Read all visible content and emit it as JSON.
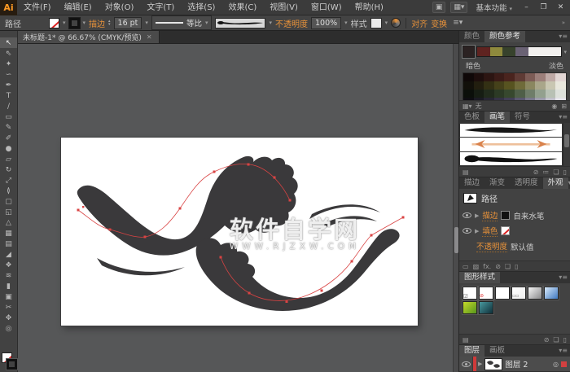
{
  "app": {
    "logo_text": "Ai",
    "workspace": "基本功能"
  },
  "menu": {
    "items": [
      "文件(F)",
      "编辑(E)",
      "对象(O)",
      "文字(T)",
      "选择(S)",
      "效果(C)",
      "视图(V)",
      "窗口(W)",
      "帮助(H)"
    ]
  },
  "window_controls": {
    "minimize": "–",
    "restore": "❐",
    "close": "✕"
  },
  "control_bar": {
    "target_label": "路径",
    "stroke_link": "描边",
    "stroke_weight": "16 pt",
    "width_profile": "等比",
    "opacity_link": "不透明度",
    "opacity_value": "100%",
    "style_label": "样式",
    "align_link": "对齐",
    "transform_link": "变换",
    "collapse_glyph": "»"
  },
  "document_tab": {
    "title": "未标题-1* @ 66.67% (CMYK/预览)",
    "close_glyph": "✕"
  },
  "toolbar": {
    "tools": [
      {
        "name": "selection-tool",
        "glyph": "↖",
        "active": true
      },
      {
        "name": "direct-selection-tool",
        "glyph": "⇖"
      },
      {
        "name": "magic-wand-tool",
        "glyph": "✦"
      },
      {
        "name": "lasso-tool",
        "glyph": "∽"
      },
      {
        "name": "pen-tool",
        "glyph": "✒"
      },
      {
        "name": "type-tool",
        "glyph": "T"
      },
      {
        "name": "line-segment-tool",
        "glyph": "∕"
      },
      {
        "name": "rectangle-tool",
        "glyph": "▭"
      },
      {
        "name": "paintbrush-tool",
        "glyph": "✎"
      },
      {
        "name": "pencil-tool",
        "glyph": "✐"
      },
      {
        "name": "blob-brush-tool",
        "glyph": "●"
      },
      {
        "name": "eraser-tool",
        "glyph": "▱"
      },
      {
        "name": "rotate-tool",
        "glyph": "↻"
      },
      {
        "name": "scale-tool",
        "glyph": "⤢"
      },
      {
        "name": "width-tool",
        "glyph": "≬"
      },
      {
        "name": "free-transform-tool",
        "glyph": "▢"
      },
      {
        "name": "shape-builder-tool",
        "glyph": "◱"
      },
      {
        "name": "perspective-grid-tool",
        "glyph": "△"
      },
      {
        "name": "mesh-tool",
        "glyph": "▦"
      },
      {
        "name": "gradient-tool",
        "glyph": "▤"
      },
      {
        "name": "eyedropper-tool",
        "glyph": "◢"
      },
      {
        "name": "blend-tool",
        "glyph": "❖"
      },
      {
        "name": "symbol-sprayer-tool",
        "glyph": "≋"
      },
      {
        "name": "column-graph-tool",
        "glyph": "▮"
      },
      {
        "name": "artboard-tool",
        "glyph": "▣"
      },
      {
        "name": "slice-tool",
        "glyph": "✂"
      },
      {
        "name": "hand-tool",
        "glyph": "✥"
      },
      {
        "name": "zoom-tool",
        "glyph": "◎"
      }
    ]
  },
  "canvas": {
    "watermark_title": "软件自学网",
    "watermark_url": "WWW.RJZXW.COM"
  },
  "panels": {
    "color_group": {
      "tabs": [
        "颜色",
        "颜色参考"
      ],
      "active_tab": "颜色参考",
      "base_color": "#2b2222",
      "harmony_colors": [
        "#5f2320",
        "#8f8a3d",
        "#37422c",
        "#6a6274",
        "#f2f0ee"
      ],
      "dark_label": "暗色",
      "light_label": "淡色",
      "grid": [
        [
          "#0f0808",
          "#1d0e0d",
          "#2c1512",
          "#3b1c18",
          "#4a241e",
          "#5f3b35",
          "#7d5c56",
          "#9c7f7a",
          "#bfaaa6",
          "#e2d6d4"
        ],
        [
          "#12100a",
          "#221e0f",
          "#333014",
          "#45411a",
          "#575320",
          "#6f6b3a",
          "#8a8760",
          "#a9a68a",
          "#c9c7b2",
          "#e8e7dc"
        ],
        [
          "#0b0f0a",
          "#161d13",
          "#212b1c",
          "#2c3a25",
          "#37482e",
          "#4f5f48",
          "#6f7d69",
          "#93a08e",
          "#b8c1b4",
          "#dde1db"
        ],
        [
          "#0e0d12",
          "#1b1a23",
          "#282634",
          "#353245",
          "#423f56",
          "#5a5770",
          "#7a788d",
          "#9d9bab",
          "#c1c0ca",
          "#e4e3e9"
        ]
      ],
      "footer_limit_label": "无",
      "footer_icons": [
        {
          "name": "edit-colors-icon",
          "glyph": "◉"
        },
        {
          "name": "save-color-group-icon",
          "glyph": "⊞"
        }
      ]
    },
    "brushes_group": {
      "tabs": [
        "色板",
        "画笔",
        "符号"
      ],
      "active_tab": "画笔",
      "brushes": [
        {
          "name": "ink-calligraphy-brush",
          "type": "ink-thin"
        },
        {
          "name": "arrow-art-brush",
          "type": "arrow"
        },
        {
          "name": "ink-art-brush",
          "type": "ink-thick"
        }
      ],
      "footer_icons": [
        {
          "name": "brush-libraries-icon",
          "glyph": "▤"
        },
        {
          "name": "remove-brush-stroke-icon",
          "glyph": "⊘"
        },
        {
          "name": "options-of-selected-object-icon",
          "glyph": "≔"
        },
        {
          "name": "new-brush-icon",
          "glyph": "❏"
        },
        {
          "name": "delete-brush-icon",
          "glyph": "▯"
        }
      ]
    },
    "appearance_group": {
      "tabs": [
        "描边",
        "渐变",
        "透明度",
        "外观"
      ],
      "active_tab": "外观",
      "target_type": "路径",
      "rows": {
        "stroke": {
          "label": "描边",
          "value": "自来水笔"
        },
        "fill": {
          "label": "填色"
        },
        "opacity": {
          "label": "不透明度",
          "value": "默认值"
        }
      },
      "footer_icons": [
        {
          "name": "new-stroke-icon",
          "glyph": "▭"
        },
        {
          "name": "new-fill-icon",
          "glyph": "▨"
        },
        {
          "name": "new-effect-fx-icon",
          "glyph": "fx."
        },
        {
          "name": "clear-appearance-icon",
          "glyph": "⊘"
        },
        {
          "name": "duplicate-item-icon",
          "glyph": "❏"
        },
        {
          "name": "delete-item-icon",
          "glyph": "▯"
        }
      ]
    },
    "styles_group": {
      "tab": "图形样式",
      "styles": [
        {
          "name": "default-graphic-style",
          "c1": "#ffffff",
          "c2": "#ffffff",
          "badge": "corner"
        },
        {
          "name": "none-graphic-style",
          "c1": "#ffffff",
          "c2": "#ffffff",
          "badge": "slash"
        },
        {
          "name": "plain-graphic-style",
          "c1": "#ffffff",
          "c2": "#ffffff",
          "badge": ""
        },
        {
          "name": "compound-graphic-style",
          "c1": "#ffffff",
          "c2": "#eeeeee",
          "badge": "squares"
        },
        {
          "name": "shadow-graphic-style",
          "c1": "#f5f5f5",
          "c2": "#88888a",
          "badge": ""
        },
        {
          "name": "blue-gradient-graphic-style",
          "c1": "#d8eafb",
          "c2": "#4079c0",
          "badge": ""
        },
        {
          "name": "leaf-graphic-style",
          "c1": "#c6db2b",
          "c2": "#56951c",
          "badge": ""
        },
        {
          "name": "water-graphic-style",
          "c1": "#49989e",
          "c2": "#0e2f39",
          "badge": ""
        }
      ],
      "footer_icons": [
        {
          "name": "style-libraries-icon",
          "glyph": "▤"
        },
        {
          "name": "break-link-icon",
          "glyph": "⊘"
        },
        {
          "name": "new-style-icon",
          "glyph": "❏"
        },
        {
          "name": "delete-style-icon",
          "glyph": "▯"
        }
      ]
    },
    "layers_group": {
      "tabs": [
        "图层",
        "画板"
      ],
      "active_tab": "图层",
      "layer": {
        "name": "图层 2"
      }
    }
  }
}
